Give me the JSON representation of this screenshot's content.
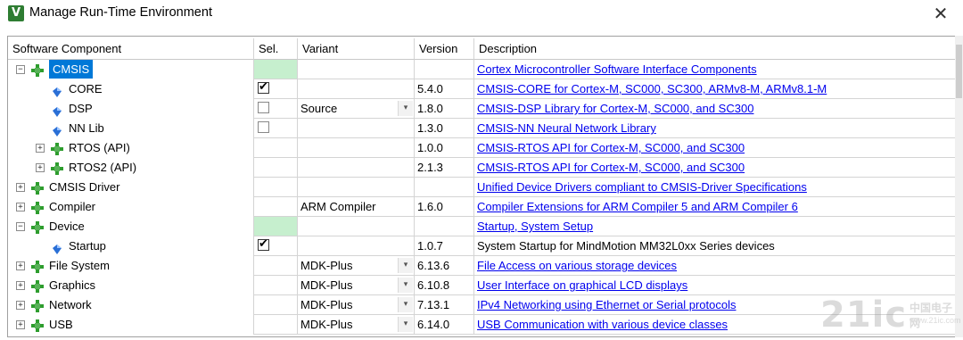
{
  "window": {
    "title": "Manage Run-Time Environment",
    "app_icon": "keil-uvision-icon",
    "close_glyph": "✕"
  },
  "columns": {
    "component": "Software Component",
    "sel": "Sel.",
    "variant": "Variant",
    "version": "Version",
    "description": "Description"
  },
  "rows": [
    {
      "name": "CMSIS",
      "level": 0,
      "expander": "−",
      "icon": "green-diamond",
      "selected": true,
      "sel_green": true,
      "checkbox": null,
      "variant": "",
      "dropdown": false,
      "version": "",
      "description": "Cortex Microcontroller Software Interface Components",
      "desc_link": true
    },
    {
      "name": "CORE",
      "level": 1,
      "expander": null,
      "icon": "blue-gem",
      "selected": false,
      "sel_green": false,
      "checkbox": "checked",
      "variant": "",
      "dropdown": false,
      "version": "5.4.0",
      "description": "CMSIS-CORE for Cortex-M, SC000, SC300, ARMv8-M, ARMv8.1-M",
      "desc_link": true
    },
    {
      "name": "DSP",
      "level": 1,
      "expander": null,
      "icon": "blue-gem",
      "selected": false,
      "sel_green": false,
      "checkbox": "empty",
      "variant": "Source",
      "dropdown": true,
      "version": "1.8.0",
      "description": "CMSIS-DSP Library for Cortex-M, SC000, and SC300",
      "desc_link": true
    },
    {
      "name": "NN Lib",
      "level": 1,
      "expander": null,
      "icon": "blue-gem",
      "selected": false,
      "sel_green": false,
      "checkbox": "empty",
      "variant": "",
      "dropdown": false,
      "version": "1.3.0",
      "description": "CMSIS-NN Neural Network Library",
      "desc_link": true
    },
    {
      "name": "RTOS (API)",
      "level": 1,
      "expander": "+",
      "icon": "green-diamond",
      "selected": false,
      "sel_green": false,
      "checkbox": null,
      "variant": "",
      "dropdown": false,
      "version": "1.0.0",
      "description": "CMSIS-RTOS API for Cortex-M, SC000, and SC300",
      "desc_link": true
    },
    {
      "name": "RTOS2 (API)",
      "level": 1,
      "expander": "+",
      "icon": "green-diamond",
      "selected": false,
      "sel_green": false,
      "checkbox": null,
      "variant": "",
      "dropdown": false,
      "version": "2.1.3",
      "description": "CMSIS-RTOS API for Cortex-M, SC000, and SC300",
      "desc_link": true
    },
    {
      "name": "CMSIS Driver",
      "level": 0,
      "expander": "+",
      "icon": "green-diamond",
      "selected": false,
      "sel_green": false,
      "checkbox": null,
      "variant": "",
      "dropdown": false,
      "version": "",
      "description": "Unified Device Drivers compliant to CMSIS-Driver Specifications",
      "desc_link": true
    },
    {
      "name": "Compiler",
      "level": 0,
      "expander": "+",
      "icon": "green-diamond",
      "selected": false,
      "sel_green": false,
      "checkbox": null,
      "variant": "ARM Compiler",
      "dropdown": false,
      "version": "1.6.0",
      "description": "Compiler Extensions for ARM Compiler 5 and ARM Compiler 6",
      "desc_link": true
    },
    {
      "name": "Device",
      "level": 0,
      "expander": "−",
      "icon": "green-diamond",
      "selected": false,
      "sel_green": true,
      "checkbox": null,
      "variant": "",
      "dropdown": false,
      "version": "",
      "description": "Startup, System Setup",
      "desc_link": true
    },
    {
      "name": "Startup",
      "level": 1,
      "expander": null,
      "icon": "blue-gem",
      "selected": false,
      "sel_green": false,
      "checkbox": "checked",
      "variant": "",
      "dropdown": false,
      "version": "1.0.7",
      "description": "System Startup for MindMotion MM32L0xx Series devices",
      "desc_link": false
    },
    {
      "name": "File System",
      "level": 0,
      "expander": "+",
      "icon": "green-diamond",
      "selected": false,
      "sel_green": false,
      "checkbox": null,
      "variant": "MDK-Plus",
      "dropdown": true,
      "version": "6.13.6",
      "description": "File Access on various storage devices",
      "desc_link": true
    },
    {
      "name": "Graphics",
      "level": 0,
      "expander": "+",
      "icon": "green-diamond",
      "selected": false,
      "sel_green": false,
      "checkbox": null,
      "variant": "MDK-Plus",
      "dropdown": true,
      "version": "6.10.8",
      "description": "User Interface on graphical LCD displays",
      "desc_link": true
    },
    {
      "name": "Network",
      "level": 0,
      "expander": "+",
      "icon": "green-diamond",
      "selected": false,
      "sel_green": false,
      "checkbox": null,
      "variant": "MDK-Plus",
      "dropdown": true,
      "version": "7.13.1",
      "description": "IPv4 Networking using Ethernet or Serial protocols",
      "desc_link": true
    },
    {
      "name": "USB",
      "level": 0,
      "expander": "+",
      "icon": "green-diamond",
      "selected": false,
      "sel_green": false,
      "checkbox": null,
      "variant": "MDK-Plus",
      "dropdown": true,
      "version": "6.14.0",
      "description": "USB Communication with various device classes",
      "desc_link": true
    }
  ],
  "watermark": {
    "big": "21ic",
    "line1": "中国电子网",
    "line2": "www.21ic.com"
  },
  "colors": {
    "selection": "#0078d7",
    "sel_green": "#c6efce",
    "link": "#0000ee",
    "diamond": "#2e9d2e",
    "gem": "#2a6fd6"
  }
}
